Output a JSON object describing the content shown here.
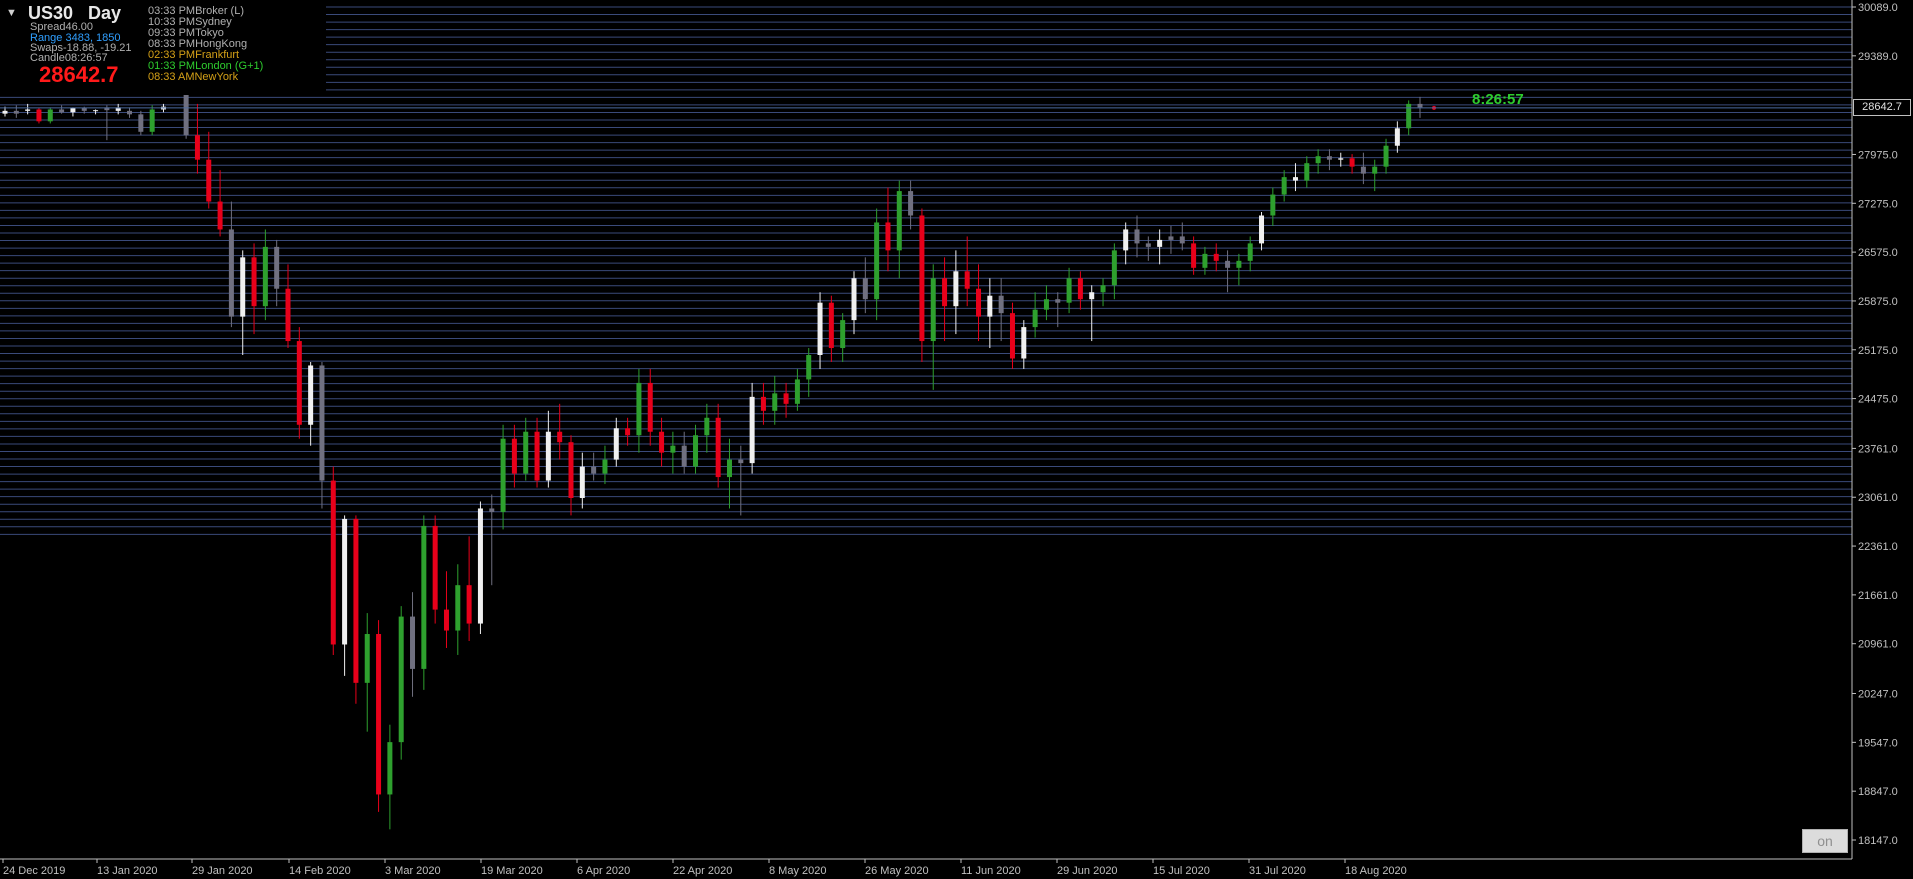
{
  "symbol_panel": {
    "menu_arrow": "▼",
    "symbol": "US30",
    "timeframe": "Day",
    "spread": "Spread46.00",
    "range": "Range 3483, 1850",
    "swaps": "Swaps-18.88, -19.21",
    "candle": "Candle08:26:57",
    "last_price": "28642.7"
  },
  "sessions": [
    {
      "time": "03:33 PM",
      "name": "Broker  (L)",
      "color": "#b0b0b0"
    },
    {
      "time": "10:33 PM",
      "name": "Sydney",
      "color": "#b0b0b0"
    },
    {
      "time": "09:33 PM",
      "name": "Tokyo",
      "color": "#b0b0b0"
    },
    {
      "time": "08:33 PM",
      "name": "HongKong",
      "color": "#b0b0b0"
    },
    {
      "time": "02:33 PM",
      "name": "Frankfurt",
      "color": "#d4a017"
    },
    {
      "time": "01:33 PM",
      "name": "London  (G+1)",
      "color": "#2ecc2e"
    },
    {
      "time": "08:33 AM",
      "name": "NewYork",
      "color": "#d4a017"
    }
  ],
  "price_tag": "28642.7",
  "countdown": "8:26:57",
  "on_button": "on",
  "colors": {
    "background": "#000000",
    "bull": "#2ea02e",
    "bear": "#e8001a",
    "neutral_white": "#f0f0f0",
    "neutral_gray": "#707080",
    "grid_lines": "#3a4a7a",
    "range_blue": "#2f9fff",
    "price_line": "#4a6aa0"
  },
  "chart_data": {
    "type": "candlestick",
    "title": "",
    "y_ticks": [
      "30089.0",
      "29389.0",
      "28642.7",
      "27975.0",
      "27275.0",
      "26575.0",
      "25875.0",
      "25175.0",
      "24475.0",
      "23761.0",
      "23061.0",
      "22361.0",
      "21661.0",
      "20961.0",
      "20247.0",
      "19547.0",
      "18847.0",
      "18147.0"
    ],
    "x_ticks": [
      "24 Dec 2019",
      "13 Jan 2020",
      "29 Jan 2020",
      "14 Feb 2020",
      "3 Mar 2020",
      "19 Mar 2020",
      "6 Apr 2020",
      "22 Apr 2020",
      "8 May 2020",
      "26 May 2020",
      "11 Jun 2020",
      "29 Jun 2020",
      "15 Jul 2020",
      "31 Jul 2020",
      "18 Aug 2020"
    ],
    "ylim": [
      18100,
      30150
    ],
    "last_price": 28642.7,
    "grid_band": [
      22450,
      30089
    ],
    "candles": [
      [
        28600,
        28660,
        28520,
        28560
      ],
      [
        28560,
        28680,
        28500,
        28600
      ],
      [
        28600,
        28700,
        28550,
        28620
      ],
      [
        28620,
        28640,
        28420,
        28450
      ],
      [
        28450,
        28650,
        28420,
        28620
      ],
      [
        28620,
        28680,
        28560,
        28580
      ],
      [
        28580,
        28650,
        28520,
        28640
      ],
      [
        28640,
        28660,
        28560,
        28600
      ],
      [
        28600,
        28620,
        28550,
        28610
      ],
      [
        28610,
        28680,
        28180,
        28650
      ],
      [
        28650,
        28700,
        28550,
        28600
      ],
      [
        28600,
        28650,
        28500,
        28550
      ],
      [
        28550,
        28600,
        28250,
        28300
      ],
      [
        28300,
        28680,
        28250,
        28620
      ],
      [
        28620,
        28700,
        28580,
        28660
      ],
      [
        29300,
        29420,
        29050,
        29100
      ],
      [
        29100,
        29250,
        28200,
        28250
      ],
      [
        28250,
        28700,
        27700,
        27900
      ],
      [
        27900,
        28300,
        27200,
        27300
      ],
      [
        27300,
        27750,
        26800,
        26900
      ],
      [
        26900,
        27300,
        25500,
        25650
      ],
      [
        25650,
        26600,
        25100,
        26500
      ],
      [
        26500,
        26700,
        25400,
        25800
      ],
      [
        25800,
        26900,
        25600,
        26650
      ],
      [
        26650,
        26750,
        25800,
        26050
      ],
      [
        26050,
        26400,
        25200,
        25300
      ],
      [
        25300,
        25500,
        23900,
        24100
      ],
      [
        24100,
        25000,
        23800,
        24950
      ],
      [
        24950,
        25000,
        22900,
        23300
      ],
      [
        23300,
        23500,
        20800,
        20950
      ],
      [
        20950,
        22800,
        20500,
        22750
      ],
      [
        22750,
        22800,
        20100,
        20400
      ],
      [
        20400,
        21400,
        19700,
        21100
      ],
      [
        21100,
        21300,
        18550,
        18800
      ],
      [
        18800,
        19800,
        18300,
        19550
      ],
      [
        19550,
        21500,
        19300,
        21350
      ],
      [
        21350,
        21700,
        20200,
        20600
      ],
      [
        20600,
        22800,
        20300,
        22650
      ],
      [
        22650,
        22800,
        21250,
        21450
      ],
      [
        21450,
        22000,
        20900,
        21150
      ],
      [
        21150,
        22100,
        20800,
        21800
      ],
      [
        21800,
        22500,
        21000,
        21250
      ],
      [
        21250,
        23000,
        21100,
        22900
      ],
      [
        22900,
        23100,
        21800,
        22850
      ],
      [
        22850,
        24100,
        22600,
        23900
      ],
      [
        23900,
        24100,
        23200,
        23400
      ],
      [
        23400,
        24200,
        23300,
        24000
      ],
      [
        24000,
        24200,
        23200,
        23300
      ],
      [
        23300,
        24300,
        23200,
        24000
      ],
      [
        24000,
        24400,
        23600,
        23850
      ],
      [
        23850,
        23950,
        22800,
        23050
      ],
      [
        23050,
        23700,
        22900,
        23500
      ],
      [
        23500,
        23700,
        23300,
        23400
      ],
      [
        23400,
        23800,
        23250,
        23600
      ],
      [
        23600,
        24200,
        23500,
        24050
      ],
      [
        24050,
        24200,
        23800,
        23950
      ],
      [
        23950,
        24900,
        23700,
        24700
      ],
      [
        24700,
        24900,
        23800,
        24000
      ],
      [
        24000,
        24200,
        23500,
        23700
      ],
      [
        23700,
        24000,
        23400,
        23800
      ],
      [
        23800,
        24000,
        23400,
        23500
      ],
      [
        23500,
        24100,
        23400,
        23950
      ],
      [
        23950,
        24400,
        23700,
        24200
      ],
      [
        24200,
        24400,
        23200,
        23350
      ],
      [
        23350,
        23900,
        22900,
        23600
      ],
      [
        23600,
        23800,
        22800,
        23550
      ],
      [
        23550,
        24700,
        23400,
        24500
      ],
      [
        24500,
        24700,
        24100,
        24300
      ],
      [
        24300,
        24800,
        24100,
        24550
      ],
      [
        24550,
        24700,
        24200,
        24400
      ],
      [
        24400,
        24900,
        24300,
        24750
      ],
      [
        24750,
        25200,
        24500,
        25100
      ],
      [
        25100,
        26000,
        24900,
        25850
      ],
      [
        25850,
        25950,
        25000,
        25200
      ],
      [
        25200,
        25700,
        25000,
        25600
      ],
      [
        25600,
        26300,
        25400,
        26200
      ],
      [
        26200,
        26500,
        25700,
        25900
      ],
      [
        25900,
        27200,
        25600,
        27000
      ],
      [
        27000,
        27500,
        26300,
        26600
      ],
      [
        26600,
        27600,
        26200,
        27450
      ],
      [
        27450,
        27600,
        26900,
        27100
      ],
      [
        27100,
        27200,
        25000,
        25300
      ],
      [
        25300,
        26400,
        24600,
        26200
      ],
      [
        26200,
        26500,
        25300,
        25800
      ],
      [
        25800,
        26600,
        25400,
        26300
      ],
      [
        26300,
        26800,
        25800,
        26050
      ],
      [
        26050,
        26400,
        25300,
        25650
      ],
      [
        25650,
        26200,
        25200,
        25950
      ],
      [
        25950,
        26200,
        25300,
        25700
      ],
      [
        25700,
        25850,
        24900,
        25050
      ],
      [
        25050,
        25600,
        24900,
        25500
      ],
      [
        25500,
        26000,
        25350,
        25750
      ],
      [
        25750,
        26100,
        25600,
        25900
      ],
      [
        25900,
        26000,
        25500,
        25850
      ],
      [
        25850,
        26350,
        25700,
        26200
      ],
      [
        26200,
        26300,
        25750,
        25900
      ],
      [
        25900,
        26100,
        25300,
        26000
      ],
      [
        26000,
        26200,
        25800,
        26100
      ],
      [
        26100,
        26700,
        25900,
        26600
      ],
      [
        26600,
        27000,
        26400,
        26900
      ],
      [
        26900,
        27100,
        26500,
        26700
      ],
      [
        26700,
        26800,
        26450,
        26650
      ],
      [
        26650,
        26900,
        26400,
        26750
      ],
      [
        26750,
        26950,
        26550,
        26800
      ],
      [
        26800,
        27000,
        26600,
        26700
      ],
      [
        26700,
        26800,
        26250,
        26350
      ],
      [
        26350,
        26650,
        26250,
        26550
      ],
      [
        26550,
        26700,
        26300,
        26450
      ],
      [
        26450,
        26600,
        26000,
        26350
      ],
      [
        26350,
        26550,
        26100,
        26450
      ],
      [
        26450,
        26800,
        26300,
        26700
      ],
      [
        26700,
        27150,
        26600,
        27100
      ],
      [
        27100,
        27500,
        26950,
        27400
      ],
      [
        27400,
        27750,
        27300,
        27650
      ],
      [
        27650,
        27850,
        27450,
        27600
      ],
      [
        27600,
        27950,
        27500,
        27850
      ],
      [
        27850,
        28050,
        27700,
        27950
      ],
      [
        27950,
        28050,
        27750,
        27900
      ],
      [
        27900,
        28000,
        27800,
        27920
      ],
      [
        27920,
        27980,
        27700,
        27800
      ],
      [
        27800,
        28000,
        27550,
        27700
      ],
      [
        27700,
        27900,
        27450,
        27800
      ],
      [
        27800,
        28200,
        27700,
        28100
      ],
      [
        28100,
        28450,
        28000,
        28350
      ],
      [
        28350,
        28750,
        28250,
        28700
      ],
      [
        28700,
        28800,
        28500,
        28650
      ]
    ]
  }
}
